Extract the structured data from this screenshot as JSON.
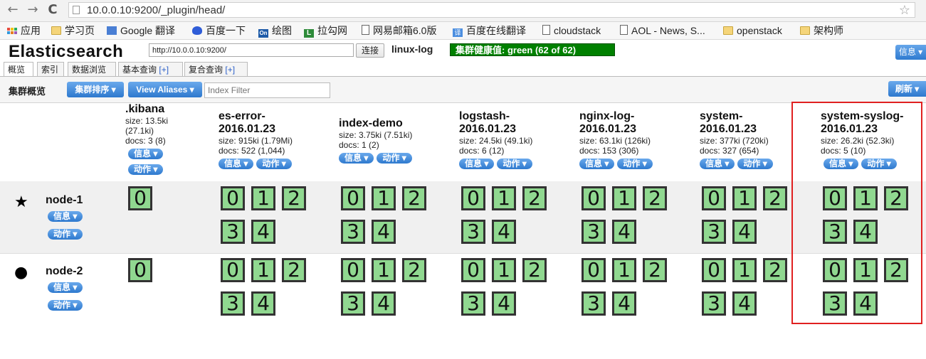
{
  "browser": {
    "url": "10.0.0.10:9200/_plugin/head/",
    "bookmarks": [
      "应用",
      "学习页",
      "Google 翻译",
      "百度一下",
      "绘图",
      "拉勾网",
      "网易邮箱6.0版",
      "百度在线翻译",
      "cloudstack",
      "AOL - News, S...",
      "openstack",
      "架构师"
    ]
  },
  "header": {
    "title": "Elasticsearch",
    "connect_url": "http://10.0.0.10:9200/",
    "connect_label": "连接",
    "cluster_name": "linux-log",
    "health": "集群健康值: green (62 of 62)",
    "info_label": "信息"
  },
  "tabs": [
    {
      "label": "概览"
    },
    {
      "label": "索引"
    },
    {
      "label": "数据浏览"
    },
    {
      "label": "基本查询",
      "plus": "[+]"
    },
    {
      "label": "复合查询",
      "plus": "[+]"
    }
  ],
  "toolbar": {
    "title": "集群概览",
    "sort_label": "集群排序",
    "aliases_label": "View Aliases",
    "filter_placeholder": "Index Filter",
    "refresh_label": "刷新"
  },
  "buttons": {
    "info": "信息",
    "action": "动作"
  },
  "indices": [
    {
      "name_lines": [
        ".kibana"
      ],
      "size": "size: 13.5ki",
      "size2": "(27.1ki)",
      "docs": "docs: 3 (8)"
    },
    {
      "name_lines": [
        "es-error-",
        "2016.01.23"
      ],
      "size": "size: 915ki (1.79Mi)",
      "size2": "",
      "docs": "docs: 522 (1,044)"
    },
    {
      "name_lines": [
        "index-demo"
      ],
      "size": "size: 3.75ki (7.51ki)",
      "size2": "",
      "docs": "docs: 1 (2)"
    },
    {
      "name_lines": [
        "logstash-",
        "2016.01.23"
      ],
      "size": "size: 24.5ki (49.1ki)",
      "size2": "",
      "docs": "docs: 6 (12)"
    },
    {
      "name_lines": [
        "nginx-log-",
        "2016.01.23"
      ],
      "size": "size: 63.1ki (126ki)",
      "size2": "",
      "docs": "docs: 153 (306)"
    },
    {
      "name_lines": [
        "system-",
        "2016.01.23"
      ],
      "size": "size: 377ki (720ki)",
      "size2": "",
      "docs": "docs: 327 (654)"
    },
    {
      "name_lines": [
        "system-syslog-",
        "2016.01.23"
      ],
      "size": "size: 26.2ki (52.3ki)",
      "size2": "",
      "docs": "docs: 5 (10)"
    }
  ],
  "nodes": [
    {
      "name": "node-1",
      "icon": "star-icon",
      "symbol": "★"
    },
    {
      "name": "node-2",
      "icon": "circle-icon",
      "symbol": "●"
    }
  ],
  "shards": {
    "kibana": [
      "0"
    ],
    "regular": [
      "0",
      "1",
      "2",
      "3",
      "4"
    ]
  }
}
